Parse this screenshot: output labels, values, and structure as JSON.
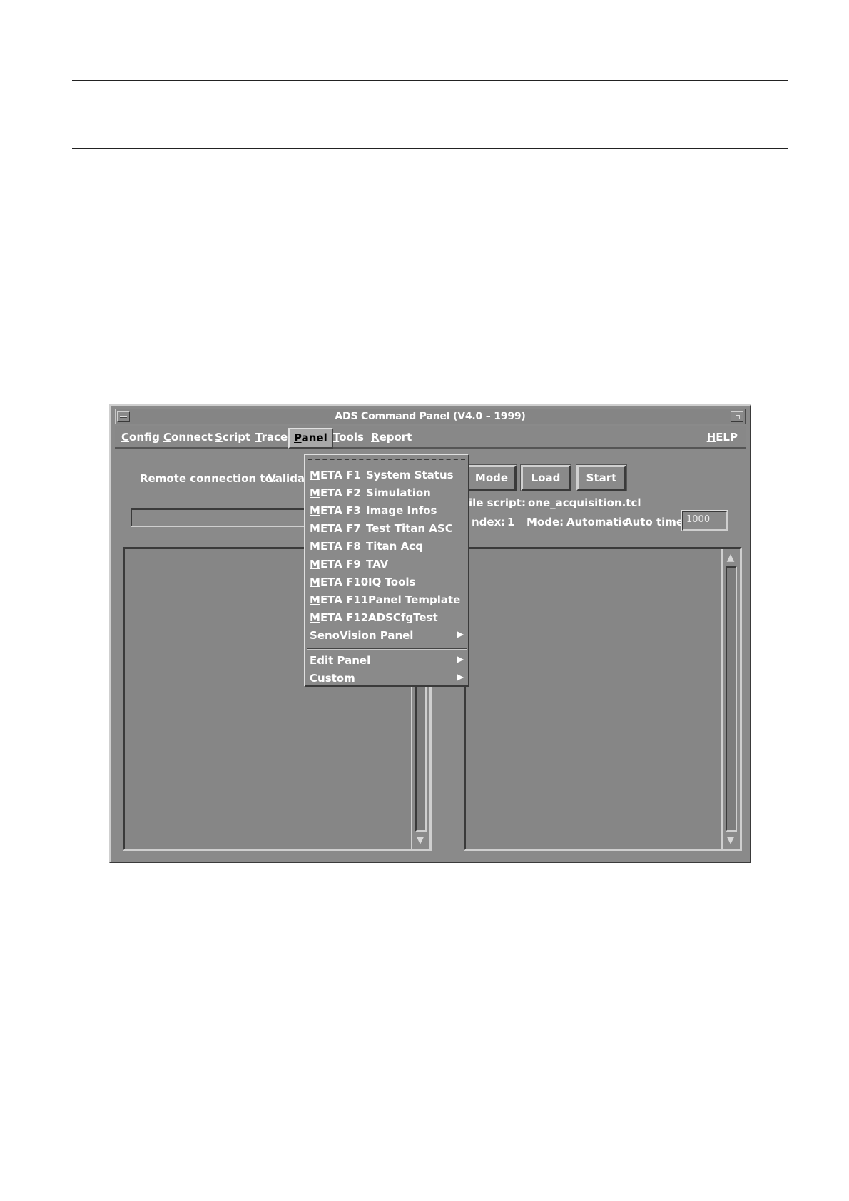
{
  "window": {
    "title": "ADS Command Panel (V4.0 – 1999)"
  },
  "menubar": {
    "items": [
      {
        "mnemonic": "C",
        "rest": "onfig"
      },
      {
        "mnemonic": "C",
        "rest": "onnect"
      },
      {
        "mnemonic": "S",
        "rest": "cript"
      },
      {
        "mnemonic": "T",
        "rest": "race"
      },
      {
        "mnemonic": "P",
        "rest": "anel"
      },
      {
        "mnemonic": "T",
        "rest": "ools"
      },
      {
        "mnemonic": "R",
        "rest": "eport"
      }
    ],
    "help": {
      "mnemonic": "H",
      "rest": "ELP"
    }
  },
  "connection": {
    "label": "Remote connection to:",
    "value": "Validat"
  },
  "buttons": {
    "mode": "Mode",
    "load": "Load",
    "start": "Start"
  },
  "script_info": {
    "label": "ile script:",
    "value": "one_acquisition.tcl"
  },
  "status": {
    "index_label": "ndex:",
    "index_value": "1",
    "mode_label": "Mode:",
    "mode_value": "Automatic",
    "auto_time_label": "Auto time:",
    "auto_time_value": "1000"
  },
  "panel_menu": {
    "items": [
      {
        "mnemonic": "M",
        "accel": "ETA F1",
        "label": "System Status"
      },
      {
        "mnemonic": "M",
        "accel": "ETA F2",
        "label": "Simulation"
      },
      {
        "mnemonic": "M",
        "accel": "ETA F3",
        "label": "Image Infos"
      },
      {
        "mnemonic": "M",
        "accel": "ETA F7",
        "label": "Test Titan ASC"
      },
      {
        "mnemonic": "M",
        "accel": "ETA F8",
        "label": "Titan Acq"
      },
      {
        "mnemonic": "M",
        "accel": "ETA F9",
        "label": "TAV"
      },
      {
        "mnemonic": "M",
        "accel": "ETA F10",
        "label": "IQ Tools"
      },
      {
        "mnemonic": "M",
        "accel": "ETA F11",
        "label": "Panel Template"
      },
      {
        "mnemonic": "M",
        "accel": "ETA F12",
        "label": "ADSCfgTest"
      }
    ],
    "submenus": [
      {
        "mnemonic": "S",
        "rest": "enoVision Panel"
      },
      {
        "mnemonic": "E",
        "rest": "dit Panel"
      },
      {
        "mnemonic": "C",
        "rest": "ustom"
      }
    ],
    "submenu_glyph": "▶"
  },
  "scroll": {
    "up_glyph": "▲",
    "down_glyph": "▼"
  },
  "colors": {
    "panel_gray": "#8a8a8a",
    "highlight": "#cfcfcf",
    "shadow": "#3a3a3a"
  }
}
